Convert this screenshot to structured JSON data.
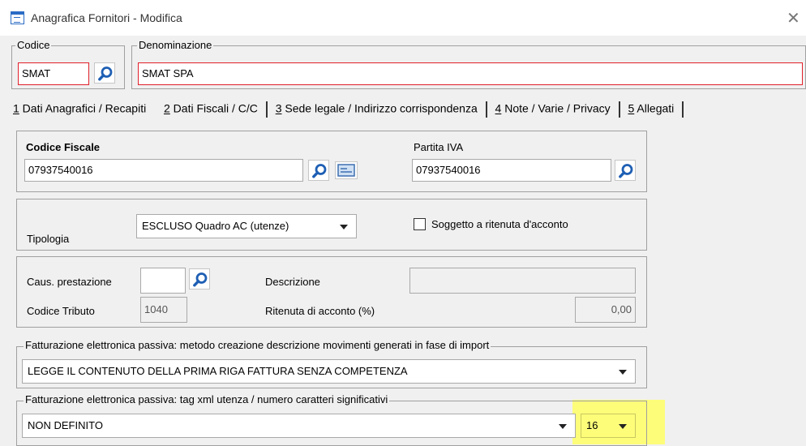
{
  "window": {
    "title": "Anagrafica Fornitori - Modifica",
    "close_glyph": "✕"
  },
  "codice": {
    "legend": "Codice",
    "value": "SMAT"
  },
  "denominazione": {
    "legend": "Denominazione",
    "value": "SMAT SPA"
  },
  "tabs": [
    {
      "num": "1",
      "label": " Dati Anagrafici / Recapiti"
    },
    {
      "num": "2",
      "label": " Dati Fiscali / C/C"
    },
    {
      "num": "3",
      "label": " Sede legale / Indirizzo corrispondenza"
    },
    {
      "num": "4",
      "label": " Note / Varie / Privacy"
    },
    {
      "num": "5",
      "label": " Allegati"
    }
  ],
  "fiscale": {
    "codice_fiscale_label": "Codice Fiscale",
    "codice_fiscale_value": "07937540016",
    "partita_iva_label": "Partita IVA",
    "partita_iva_value": "07937540016"
  },
  "tipologia": {
    "label": "Tipologia",
    "selected": "ESCLUSO Quadro AC (utenze)",
    "ritenuta_checkbox_label": "Soggetto a ritenuta d'acconto",
    "ritenuta_checked": false
  },
  "prestazione": {
    "caus_label": "Caus. prestazione",
    "caus_value": "",
    "descrizione_label": "Descrizione",
    "descrizione_value": "",
    "codice_tributo_label": "Codice Tributo",
    "codice_tributo_value": "1040",
    "ritenuta_label": "Ritenuta di acconto (%)",
    "ritenuta_value": "0,00"
  },
  "fe_metodo": {
    "legend": "Fatturazione elettronica passiva: metodo creazione descrizione movimenti generati in fase di import",
    "selected": "LEGGE IL CONTENUTO DELLA PRIMA RIGA FATTURA SENZA COMPETENZA"
  },
  "fe_tag": {
    "legend": "Fatturazione elettronica passiva: tag xml utenza / numero caratteri significativi",
    "selected": "NON DEFINITO",
    "caratteri": "16"
  },
  "colors": {
    "accent_blue": "#1e5fb4",
    "error_red": "#e0202a",
    "highlight_yellow": "#fdfd7a"
  },
  "icons": [
    "app-window-icon",
    "close-icon",
    "search-icon",
    "card-icon",
    "dropdown-arrow-icon",
    "checkbox-icon"
  ]
}
